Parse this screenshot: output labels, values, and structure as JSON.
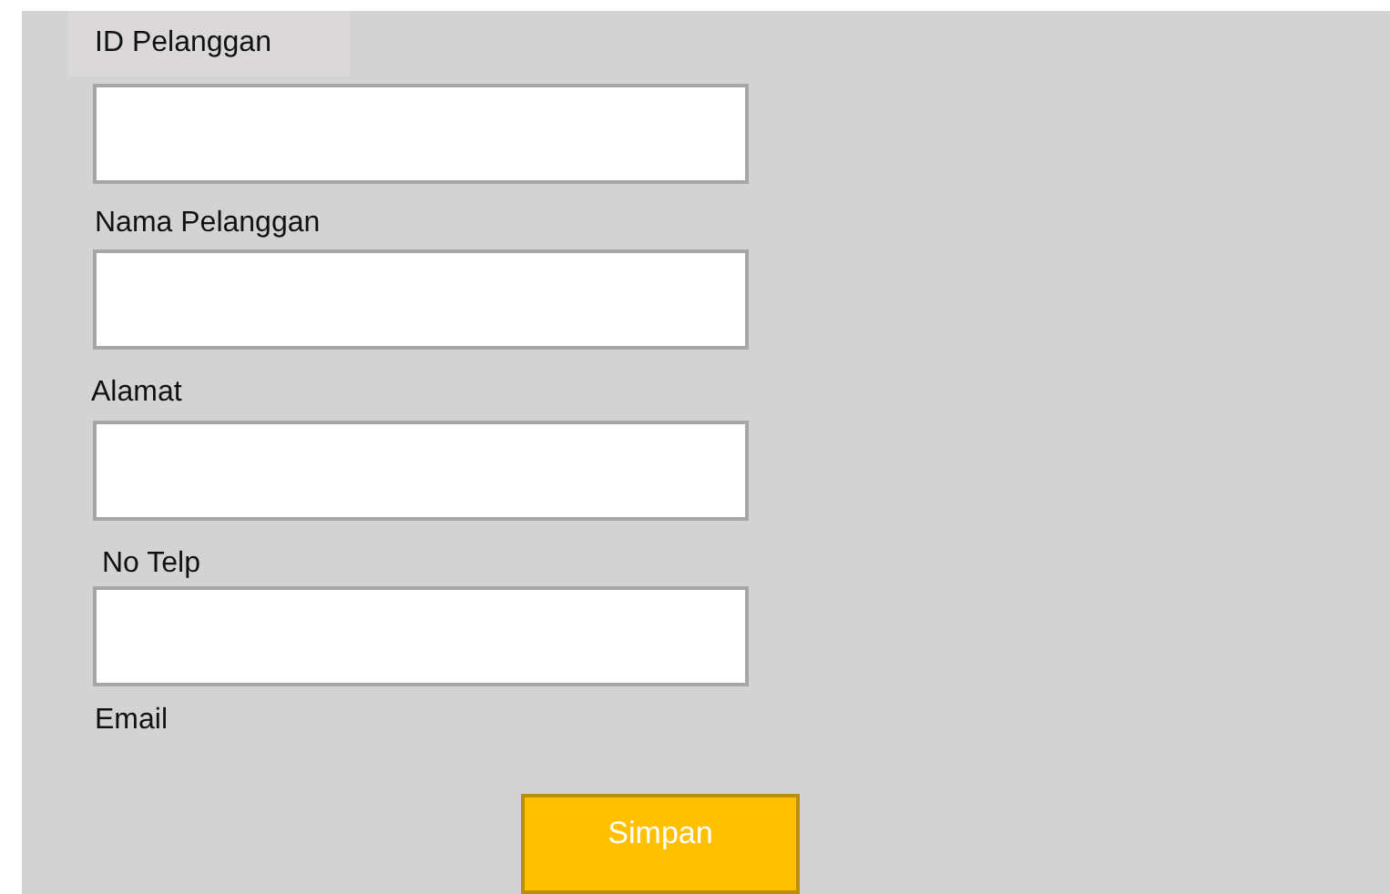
{
  "fields": [
    {
      "label": "ID Pelanggan",
      "label_highlighted": true,
      "kind": "text-box"
    },
    {
      "label": "Nama Pelanggan",
      "label_highlighted": false,
      "kind": "text-box"
    },
    {
      "label": "Alamat",
      "label_highlighted": false,
      "kind": "text-box"
    },
    {
      "label": "No Telp",
      "label_highlighted": false,
      "kind": "text-box"
    },
    {
      "label": "Email",
      "label_highlighted": false,
      "kind": "label-only"
    }
  ],
  "button": {
    "label": "Simpan"
  }
}
